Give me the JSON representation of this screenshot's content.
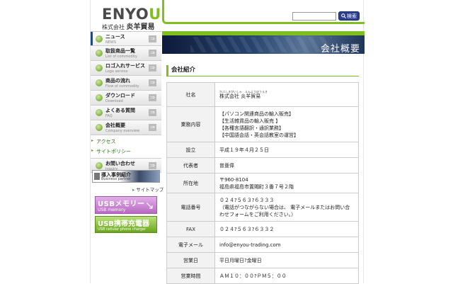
{
  "header": {
    "logo_main": "ENYO",
    "logo_accent": "U",
    "logo_sub_prefix": "株式会社",
    "logo_sub_name": "炎羊貿易",
    "search_placeholder": "",
    "search_button": "検索"
  },
  "sidebar": {
    "items": [
      {
        "jp": "ニュース",
        "en": "NEWS"
      },
      {
        "jp": "取扱商品一覧",
        "en": "List of commodity"
      },
      {
        "jp": "ロゴ入れサービス",
        "en": "Logo service"
      },
      {
        "jp": "商品の流れ",
        "en": "Flow of commodity"
      },
      {
        "jp": "ダウンロード",
        "en": "Download"
      },
      {
        "jp": "よくある質問",
        "en": "FAQ"
      },
      {
        "jp": "会社概要",
        "en": "Company overview"
      }
    ],
    "sub_items": [
      "アクセス",
      "サイトポリシー"
    ],
    "contact": {
      "jp": "お問い合わせ",
      "en": "Inquiry"
    },
    "case_banner": {
      "title": "導入事例紹介",
      "subtitle": "Business partner"
    },
    "sitemap": "サイトマップ",
    "usb_memory": {
      "title": "USBメモリー",
      "subtitle": "USB memory"
    },
    "usb_charger": {
      "title": "USB携帯充電器",
      "subtitle": "USB cellular phone charger"
    }
  },
  "banner": {
    "title": "会社概要"
  },
  "section": {
    "title": "会社紹介"
  },
  "company_table": [
    {
      "label": "社名",
      "lines": [
        "株式会社 炎羊貿易"
      ],
      "ruby": "かぶしきがいしゃ　えんようぼうえき"
    },
    {
      "label": "業務内容",
      "lines": [
        "【パソコン関連商品の輸入販売】",
        "【生活雑貨品の輸入販売 】",
        "【各種言語翻訳・通訳業務】",
        "【中国語会話・英会話教室の運営】"
      ]
    },
    {
      "label": "設立",
      "lines": [
        "平成１９年４月２５日"
      ]
    },
    {
      "label": "代表者",
      "lines": [
        "曽亜偉"
      ]
    },
    {
      "label": "所在地",
      "lines": [
        "〒960-8104",
        "福島県福島市置賜町３番７号２階"
      ]
    },
    {
      "label": "電話番号",
      "lines": [
        "０２４?５６３?６３３３",
        "（電話がつながらない場合は、 電子メールまたはお問い合わせフォームをご利用ください。）"
      ]
    },
    {
      "label": "FAX",
      "lines": [
        "０２４?５６３?６３３２"
      ]
    },
    {
      "label": "電子メール",
      "lines": [
        "info@enyou-trading.com"
      ]
    },
    {
      "label": "営業日",
      "lines": [
        "平日月曜日?金曜日"
      ]
    },
    {
      "label": "営業時間",
      "lines": [
        "ＡＭ１０：００?ＰＭ５：００"
      ]
    }
  ]
}
